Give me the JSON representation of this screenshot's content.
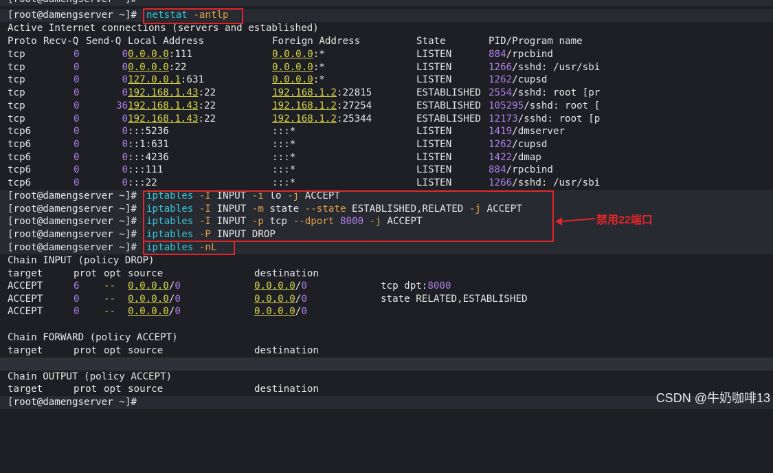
{
  "prompt": "[root@damengserver ~]#",
  "top_partial": "[root@damengserver ~]#",
  "cmd_netstat": "netstat -antlp",
  "active_header": "Active Internet connections (servers and established)",
  "netstat_cols": {
    "proto": "Proto",
    "recvq": "Recv-Q",
    "sendq": "Send-Q",
    "local": "Local Address",
    "foreign": "Foreign Address",
    "state": "State",
    "pid": "PID/Program name"
  },
  "netstat_rows": [
    {
      "proto": "tcp",
      "recvq": "0",
      "sendq": "0",
      "local": "0.0.0.0:111",
      "foreign": "0.0.0.0:*",
      "state": "LISTEN",
      "pid": "884",
      "prog": "/rpcbind"
    },
    {
      "proto": "tcp",
      "recvq": "0",
      "sendq": "0",
      "local": "0.0.0.0:22",
      "foreign": "0.0.0.0:*",
      "state": "LISTEN",
      "pid": "1266",
      "prog": "/sshd: /usr/sbi"
    },
    {
      "proto": "tcp",
      "recvq": "0",
      "sendq": "0",
      "local": "127.0.0.1:631",
      "foreign": "0.0.0.0:*",
      "state": "LISTEN",
      "pid": "1262",
      "prog": "/cupsd"
    },
    {
      "proto": "tcp",
      "recvq": "0",
      "sendq": "0",
      "local": "192.168.1.43:22",
      "foreign": "192.168.1.2:22815",
      "state": "ESTABLISHED",
      "pid": "2554",
      "prog": "/sshd: root [pr"
    },
    {
      "proto": "tcp",
      "recvq": "0",
      "sendq": "36",
      "local": "192.168.1.43:22",
      "foreign": "192.168.1.2:27254",
      "state": "ESTABLISHED",
      "pid": "105295",
      "prog": "/sshd: root ["
    },
    {
      "proto": "tcp",
      "recvq": "0",
      "sendq": "0",
      "local": "192.168.1.43:22",
      "foreign": "192.168.1.2:25344",
      "state": "ESTABLISHED",
      "pid": "12173",
      "prog": "/sshd: root [p"
    },
    {
      "proto": "tcp6",
      "recvq": "0",
      "sendq": "0",
      "local": ":::5236",
      "foreign": ":::*",
      "state": "LISTEN",
      "pid": "1419",
      "prog": "/dmserver"
    },
    {
      "proto": "tcp6",
      "recvq": "0",
      "sendq": "0",
      "local": "::1:631",
      "foreign": ":::*",
      "state": "LISTEN",
      "pid": "1262",
      "prog": "/cupsd"
    },
    {
      "proto": "tcp6",
      "recvq": "0",
      "sendq": "0",
      "local": ":::4236",
      "foreign": ":::*",
      "state": "LISTEN",
      "pid": "1422",
      "prog": "/dmap"
    },
    {
      "proto": "tcp6",
      "recvq": "0",
      "sendq": "0",
      "local": ":::111",
      "foreign": ":::*",
      "state": "LISTEN",
      "pid": "884",
      "prog": "/rpcbind"
    },
    {
      "proto": "tcp6",
      "recvq": "0",
      "sendq": "0",
      "local": ":::22",
      "foreign": ":::*",
      "state": "LISTEN",
      "pid": "1266",
      "prog": "/sshd: /usr/sbi"
    }
  ],
  "iptables_cmds": [
    "iptables -I INPUT -i lo -j ACCEPT",
    "iptables -I INPUT -m state --state ESTABLISHED,RELATED -j ACCEPT",
    "iptables -I INPUT -p tcp --dport 8000 -j ACCEPT",
    "iptables -P INPUT DROP"
  ],
  "cmd_list": "iptables -nL",
  "annotation": "禁用22端口",
  "chains": {
    "input_header": "Chain INPUT (policy DROP)",
    "forward_header": "Chain FORWARD (policy ACCEPT)",
    "output_header": "Chain OUTPUT (policy ACCEPT)",
    "cols": {
      "target": "target",
      "prot": "prot",
      "opt": "opt",
      "source": "source",
      "destination": "destination"
    },
    "input_rows": [
      {
        "target": "ACCEPT",
        "prot": "6",
        "opt": "--",
        "source": "0.0.0.0/0",
        "destination": "0.0.0.0/0",
        "extra": "tcp dpt:8000"
      },
      {
        "target": "ACCEPT",
        "prot": "0",
        "opt": "--",
        "source": "0.0.0.0/0",
        "destination": "0.0.0.0/0",
        "extra": "state RELATED,ESTABLISHED"
      },
      {
        "target": "ACCEPT",
        "prot": "0",
        "opt": "--",
        "source": "0.0.0.0/0",
        "destination": "0.0.0.0/0",
        "extra": ""
      }
    ]
  },
  "watermark": "CSDN @牛奶咖啡13",
  "colors": {
    "background": "#1d1f24",
    "command": "#36c6d9",
    "flag": "#e19f4b",
    "number": "#b07ee8",
    "address": "#d9d649",
    "highlight_box": "#e0262b"
  }
}
